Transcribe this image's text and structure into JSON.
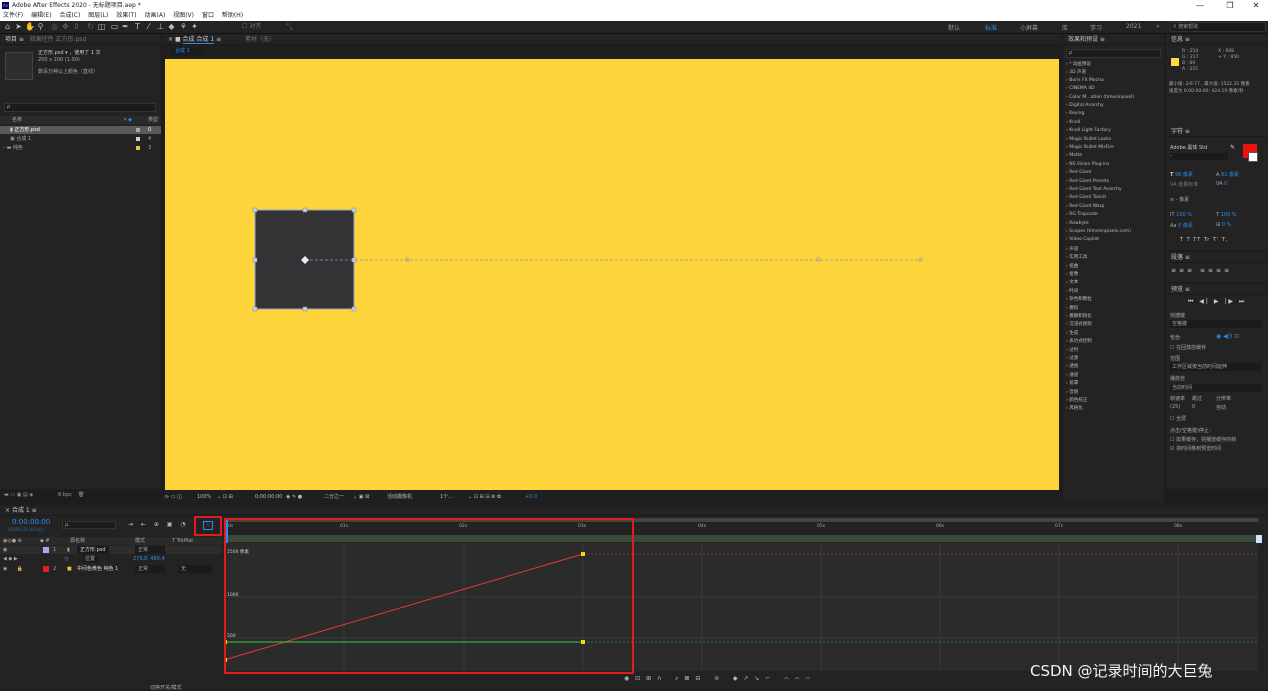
{
  "titlebar": {
    "title": "Adobe After Effects 2020 - 无标题项目.aep *",
    "minimize": "—",
    "maximize": "❐",
    "close": "✕"
  },
  "menu": [
    "文件(F)",
    "编辑(E)",
    "合成(C)",
    "图层(L)",
    "效果(T)",
    "动画(A)",
    "视图(V)",
    "窗口",
    "帮助(H)"
  ],
  "toolbar": {
    "snap": "对齐",
    "workspaces": [
      "默认",
      "标准",
      "小屏幕",
      "库",
      "学习",
      "2021"
    ],
    "active_workspace": "标准",
    "search_placeholder": "搜索帮助"
  },
  "project": {
    "tab_project": "项目",
    "tab_fx": "效果控件 正方形.psd",
    "selected_name": "正方形.psd ▾ ，使用了 1 次",
    "selected_info": "200 x 200 (1.00)",
    "selected_info2": "数百万种以上颜色（直线）",
    "search_placeholder": "ρ",
    "col_name": "名称",
    "col_type": "类型",
    "items": [
      {
        "name": "正方形.psd",
        "color": "#aaaaaa",
        "sel": true,
        "n": "0"
      },
      {
        "name": "合成 1",
        "color": "#cfcfcf",
        "sel": false,
        "n": "4"
      },
      {
        "name": "纯色",
        "color": "#e8c83a",
        "sel": false,
        "n": "3"
      }
    ],
    "bpc": "8 bpc"
  },
  "comp": {
    "tab_comp": "合成 合成 1",
    "tab_footage": "素材（无）",
    "subtab": "合成 1",
    "zoom": "100%",
    "timecode": "0:00:00:00",
    "quality": "二分之一",
    "view": "活动摄像机",
    "views": "1个...",
    "exposure": "+0.0"
  },
  "fx_presets": {
    "title": "效果和预设",
    "items": [
      "* 动画预设",
      "3D 声道",
      "Boris FX Mocha",
      "CINEMA 4D",
      "Color M...ation (timesinpixel)",
      "Digital Anarchy",
      "Keying",
      "Knoll",
      "Knoll Light Factory",
      "Magic Bullet Looks",
      "Magic Bullet MisFire",
      "Matte",
      "NS Vision Plug-ins",
      "Red Giant",
      "Red Giant Presets",
      "Red Giant Text Anarchy",
      "Red Giant Toonit",
      "Red Giant Warp",
      "RG Trapcode",
      "Rowbyte",
      "Scopes (timesinpixels.com)",
      "Video Copilot",
      "声道",
      "实用工具",
      "扭曲",
      "抠像",
      "文本",
      "时间",
      "杂色和颗粒",
      "模拟",
      "模糊和锐化",
      "沉浸式视频",
      "生成",
      "表达式控制",
      "过时",
      "过渡",
      "透视",
      "通道",
      "遮罩",
      "音频",
      "颜色校正",
      "风格化"
    ]
  },
  "info": {
    "title": "信息",
    "r": "R : 254",
    "g": "G : 217",
    "b": "B : 69",
    "a": "A : 255",
    "x": "X : 608",
    "y": "+ Y : 950",
    "line1": "最小值: 2/9.77 , 最大值: 1522.35 像素",
    "line2": "速度为 0:00:00:00: 424.19 像素/秒",
    "color": "#fed945"
  },
  "char": {
    "title": "字符",
    "font": "Adobe 黑体 Std",
    "style": "-",
    "size": "96 像素",
    "leading": "81 像素",
    "tracking": "度量标准",
    "kern": "0",
    "stroke": "- 像素",
    "vscale": "100 %",
    "hscale": "100 %",
    "baseline": "0 像素",
    "tsume": "0 %",
    "styles": "T T TT Tr T' T,"
  },
  "para": {
    "title": "段落"
  },
  "preview": {
    "title": "预览",
    "shortcut_label": "快捷键",
    "shortcut": "空格键",
    "include": "包含:",
    "cache": "在回放前缓存",
    "range_label": "范围",
    "range": "工作区域按当前时间延伸",
    "play_from": "播放自",
    "play_from_val": "当前时间",
    "fps_label": "帧速率",
    "skip_label": "跳过",
    "res_label": "分辨率",
    "fps": "(25)",
    "skip": "0",
    "res": "自动",
    "fullscreen": "全屏",
    "stop_label": "点击(空格键)停止：",
    "cb1": "如果缓存，则播放缓存的帧",
    "cb2": "将时间移到预览时间"
  },
  "timeline": {
    "tab": "合成 1",
    "timecode": "0:00:00:00",
    "fps_sub": "00000 (25.00 fps)",
    "search": "ρ.",
    "col_src": "源名称",
    "col_mode": "模式",
    "col_t": "T TrkMat",
    "layers": [
      {
        "num": "1",
        "name": "正方形.psd",
        "mode": "正常",
        "color": "#a8a8ff"
      },
      {
        "num": "",
        "name": "位置",
        "mode": "",
        "value": "279.8, 485.4",
        "color": ""
      },
      {
        "num": "2",
        "name": "中间色黄色 纯色 1",
        "mode": "正常",
        "track": "无",
        "color": "#e02020"
      }
    ],
    "ticks": [
      "0s",
      "01s",
      "02s",
      "03s",
      "04s",
      "05s",
      "06s",
      "07s",
      "08s"
    ],
    "graph": {
      "y_top": "2500 像素",
      "y_mid": "1000",
      "y_bot": "500"
    },
    "bottom": "切换开关/模式"
  },
  "watermark": "CSDN @记录时间的大巨兔"
}
